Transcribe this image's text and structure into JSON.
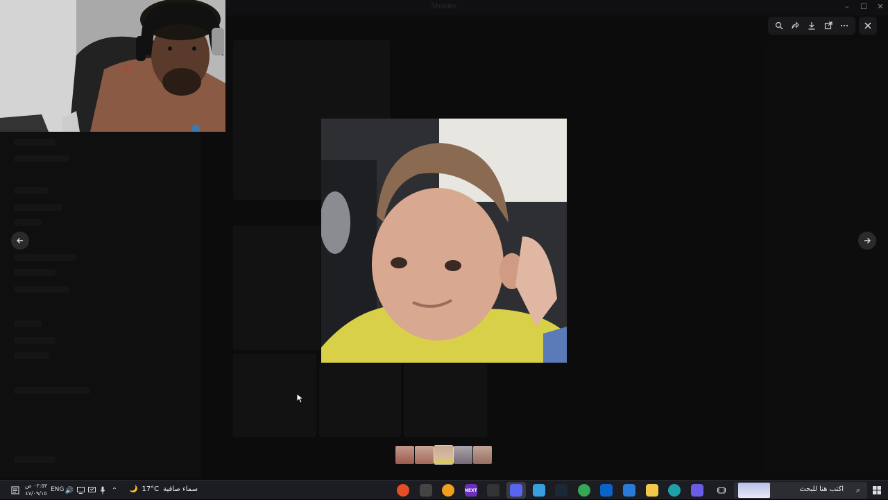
{
  "app": {
    "title": "Stroder"
  },
  "viewer": {
    "toolbar": {
      "zoom_icon": "zoom-in-icon",
      "share_icon": "forward-icon",
      "download_icon": "download-icon",
      "open_icon": "open-external-icon",
      "more_icon": "more-icon"
    },
    "close_icon": "close-icon",
    "prev_icon": "arrow-left-icon",
    "next_icon": "arrow-right-icon",
    "thumbnails": [
      {
        "color": "#c98a7a"
      },
      {
        "color": "#d49a8c"
      },
      {
        "color": "#b89a70",
        "active": true
      },
      {
        "color": "#a8a0a8"
      },
      {
        "color": "#caa090"
      }
    ]
  },
  "taskbar": {
    "clock_time": "٠٢:٥٣ ص",
    "clock_date": "٤٧/٠٩/١٥",
    "language": "ENG",
    "weather_temp": "17°C",
    "weather_text": "سماء صافية",
    "search_placeholder": "اكتب هنا للبحث",
    "apps": [
      {
        "name": "chrome-icon",
        "color": "#e44d26"
      },
      {
        "name": "obs-icon",
        "color": "#444"
      },
      {
        "name": "chrome-canary-icon",
        "color": "#f0a020"
      },
      {
        "name": "next-app-icon",
        "color": "#6b2fbf",
        "label": "NEXT"
      },
      {
        "name": "capcut-icon",
        "color": "#333"
      },
      {
        "name": "discord-icon",
        "color": "#5865f2",
        "active": true
      },
      {
        "name": "copilot-icon",
        "color": "#39a0e0"
      },
      {
        "name": "steam-icon",
        "color": "#1b2838"
      },
      {
        "name": "google-chrome-icon",
        "color": "#34a853"
      },
      {
        "name": "outlook-icon",
        "color": "#0a64c8"
      },
      {
        "name": "store-icon",
        "color": "#2a7ad8"
      },
      {
        "name": "file-explorer-icon",
        "color": "#f2c84b"
      },
      {
        "name": "edge-icon",
        "color": "#1fa0a8"
      },
      {
        "name": "copilot-app-icon",
        "color": "#6a5ce6"
      },
      {
        "name": "task-view-icon",
        "color": "#2b2c30"
      }
    ]
  }
}
